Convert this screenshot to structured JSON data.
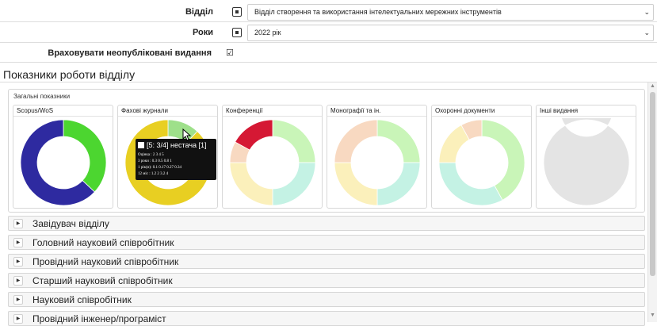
{
  "form": {
    "department_label": "Відділ",
    "department_value": "Відділ створення та використання інтелектуальних мережних інструментів",
    "years_label": "Роки",
    "years_value": "2022 рік",
    "unpublished_label": "Враховувати неопубліковані видання",
    "unpublished_checked": "☑"
  },
  "section_title": "Показники роботи відділу",
  "summary": {
    "title": "Загальні показники",
    "charts": [
      {
        "title": "Scopus/WoS",
        "segments": [
          {
            "value": 37,
            "color": "#4cd630"
          },
          {
            "value": 63,
            "color": "#2e2aa0"
          }
        ]
      },
      {
        "title": "Фахові журнали",
        "segments": [
          {
            "value": 12,
            "color": "#9ee08a"
          },
          {
            "value": 88,
            "color": "#e8cf22"
          }
        ]
      },
      {
        "title": "Конференції",
        "segments": [
          {
            "value": 25,
            "color": "#c9f5b8"
          },
          {
            "value": 25,
            "color": "#c4f2e4"
          },
          {
            "value": 25,
            "color": "#fbf0bb"
          },
          {
            "value": 8,
            "color": "#f8d9c1"
          },
          {
            "value": 17,
            "color": "#d51834"
          }
        ]
      },
      {
        "title": "Монографії та ін.",
        "segments": [
          {
            "value": 25,
            "color": "#c9f5b8"
          },
          {
            "value": 25,
            "color": "#c4f2e4"
          },
          {
            "value": 25,
            "color": "#fbf0bb"
          },
          {
            "value": 25,
            "color": "#f8d9c1"
          }
        ]
      },
      {
        "title": "Охоронні документи",
        "segments": [
          {
            "value": 42,
            "color": "#c9f5b8"
          },
          {
            "value": 33,
            "color": "#c4f2e4"
          },
          {
            "value": 17,
            "color": "#fbf0bb"
          },
          {
            "value": 8,
            "color": "#f8d9c1"
          }
        ]
      },
      {
        "title": "Інші видання",
        "segments": [
          {
            "value": 100,
            "color": "#e4e4e4"
          }
        ]
      }
    ]
  },
  "tooltip": {
    "header": "[5: 3/4] нестача [1]",
    "rows": [
      "Оцінка  : 2     3     4     5",
      "3 роки  : 0.3   0.5   0.8   1",
      "1 рік(н): 0.1   0.17  0.27  0.34",
      "12 міс  : 1.2   2     3.2   4"
    ]
  },
  "accordion": [
    "Завідувач відділу",
    "Головний науковий співробітник",
    "Провідний науковий співробітник",
    "Старший науковий співробітник",
    "Науковий співробітник",
    "Провідний інженер/програміст"
  ],
  "icons": {
    "select_toggle": "square-dot-icon",
    "dropdown": "chevron-down-icon",
    "accordion": "triangle-right-icon"
  }
}
